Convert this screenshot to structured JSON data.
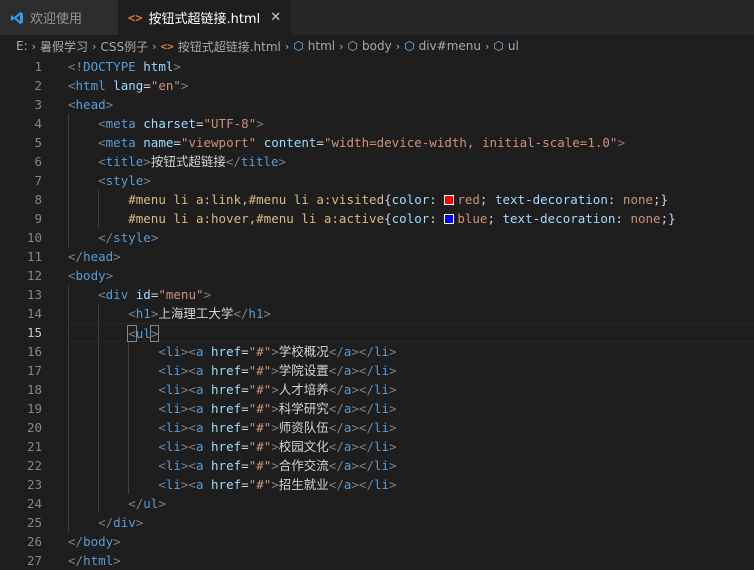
{
  "tabs": [
    {
      "label": "欢迎使用",
      "icon": "vscode-logo-icon",
      "active": false
    },
    {
      "label": "按钮式超链接.html",
      "icon": "html-file-icon",
      "active": true
    }
  ],
  "breadcrumb": {
    "items": [
      "E:",
      "暑假学习",
      "CSS例子",
      "按钮式超链接.html",
      "html",
      "body",
      "div#menu",
      "ul"
    ]
  },
  "colors": {
    "red_swatch": "#ff0000",
    "blue_swatch": "#0000ff"
  },
  "code": {
    "l1": {
      "a": "<!",
      "b": "DOCTYPE",
      "c": " html",
      ">": ">"
    },
    "l2": {
      "tag": "html",
      "attr": "lang",
      "val": "\"en\""
    },
    "l3": {
      "tag": "head"
    },
    "l4": {
      "tag": "meta",
      "attr": "charset",
      "val": "\"UTF-8\""
    },
    "l5": {
      "tag": "meta",
      "attr1": "name",
      "val1": "\"viewport\"",
      "attr2": "content",
      "val2": "\"width=device-width, initial-scale=1.0\""
    },
    "l6": {
      "tag": "title",
      "text": "按钮式超链接"
    },
    "l7": {
      "tag": "style"
    },
    "l8": {
      "sel": "#menu li a:link,#menu li a:visited",
      "prop1": "color",
      "val1": "red",
      "prop2": "text-decoration",
      "val2": "none"
    },
    "l9": {
      "sel": "#menu li a:hover,#menu li a:active",
      "prop1": "color",
      "val1": "blue",
      "prop2": "text-decoration",
      "val2": "none"
    },
    "l13": {
      "tag": "div",
      "attr": "id",
      "val": "\"menu\""
    },
    "l14": {
      "tag": "h1",
      "text": "上海理工大学"
    },
    "l15": {
      "tag": "ul"
    },
    "links": [
      "学校概况",
      "学院设置",
      "人才培养",
      "科学研究",
      "师资队伍",
      "校园文化",
      "合作交流",
      "招生就业"
    ],
    "href_attr": "href",
    "href_val": "\"#\""
  }
}
